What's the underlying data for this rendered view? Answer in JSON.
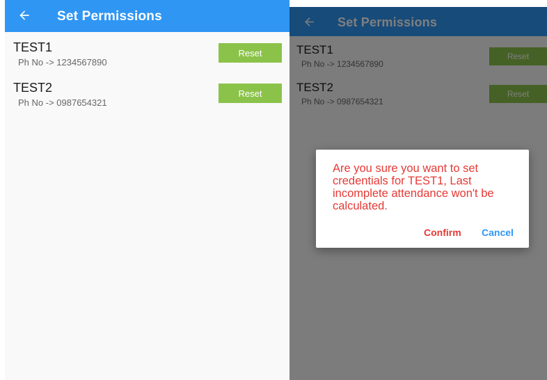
{
  "colors": {
    "appbar": "#2f96f4",
    "reset_button": "#8bc34a",
    "dialog_message": "#e53935",
    "confirm": "#e53935",
    "cancel": "#2f96f4"
  },
  "left": {
    "header": {
      "back_icon": "arrow-left-icon",
      "title": "Set Permissions"
    },
    "users": [
      {
        "name": "TEST1",
        "phone": "Ph No -> 1234567890",
        "action_label": "Reset"
      },
      {
        "name": "TEST2",
        "phone": "Ph No -> 0987654321",
        "action_label": "Reset"
      }
    ]
  },
  "right": {
    "header": {
      "back_icon": "arrow-left-icon",
      "title": "Set Permissions"
    },
    "users": [
      {
        "name": "TEST1",
        "phone": "Ph No -> 1234567890",
        "action_label": "Reset"
      },
      {
        "name": "TEST2",
        "phone": "Ph No -> 0987654321",
        "action_label": "Reset"
      }
    ],
    "dialog": {
      "message": "Are you sure you want to set credentials for TEST1, Last incomplete attendance won't be calculated.",
      "confirm_label": "Confirm",
      "cancel_label": "Cancel"
    }
  }
}
